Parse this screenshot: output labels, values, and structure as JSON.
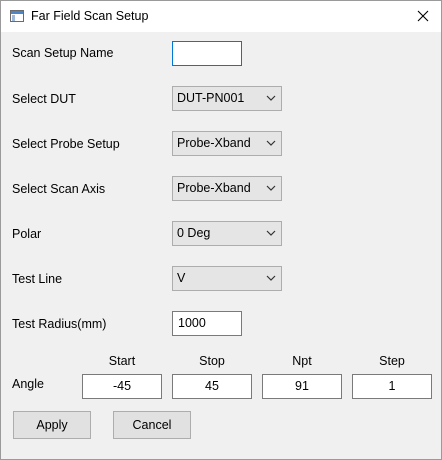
{
  "window": {
    "title": "Far Field Scan Setup",
    "icon": "window-app-icon",
    "close_icon": "close-icon"
  },
  "form": {
    "scan_setup_name": {
      "label": "Scan Setup Name",
      "value": ""
    },
    "select_dut": {
      "label": "Select DUT",
      "value": "DUT-PN001"
    },
    "select_probe_setup": {
      "label": "Select Probe Setup",
      "value": "Probe-Xband"
    },
    "select_scan_axis": {
      "label": "Select Scan Axis",
      "value": "Probe-Xband"
    },
    "polar": {
      "label": "Polar",
      "value": "0 Deg"
    },
    "test_line": {
      "label": "Test Line",
      "value": "V"
    },
    "test_radius": {
      "label": "Test Radius(mm)",
      "value": "1000"
    }
  },
  "angle": {
    "label": "Angle",
    "headers": {
      "start": "Start",
      "stop": "Stop",
      "npt": "Npt",
      "step": "Step"
    },
    "values": {
      "start": "-45",
      "stop": "45",
      "npt": "91",
      "step": "1"
    }
  },
  "buttons": {
    "apply": "Apply",
    "cancel": "Cancel"
  }
}
